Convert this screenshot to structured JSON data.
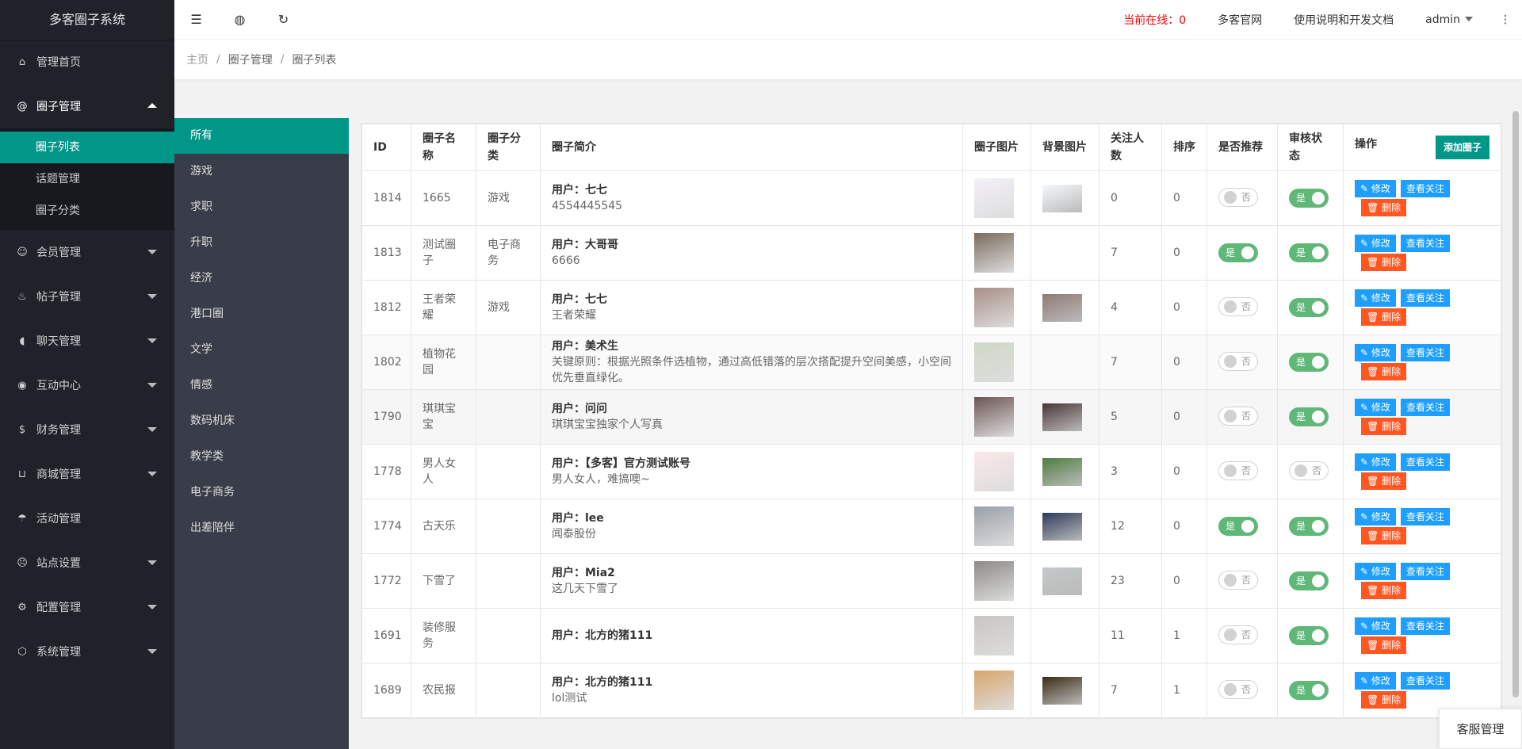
{
  "app": {
    "title": "多客圈子系统"
  },
  "sidebar": {
    "items": [
      {
        "label": "管理首页",
        "icon": "home-icon",
        "glyph": "⌂"
      },
      {
        "label": "圈子管理",
        "icon": "at-icon",
        "glyph": "@",
        "open": true,
        "subs": [
          {
            "label": "圈子列表",
            "active": true
          },
          {
            "label": "话题管理"
          },
          {
            "label": "圈子分类"
          }
        ]
      },
      {
        "label": "会员管理",
        "icon": "user-icon",
        "glyph": "☺",
        "arrow": true
      },
      {
        "label": "帖子管理",
        "icon": "fire-icon",
        "glyph": "♨",
        "arrow": true
      },
      {
        "label": "聊天管理",
        "icon": "speaker-icon",
        "glyph": "◖",
        "arrow": true
      },
      {
        "label": "互动中心",
        "icon": "compass-icon",
        "glyph": "◉",
        "arrow": true
      },
      {
        "label": "财务管理",
        "icon": "dollar-icon",
        "glyph": "$",
        "arrow": true
      },
      {
        "label": "商城管理",
        "icon": "cart-icon",
        "glyph": "⊔",
        "arrow": true
      },
      {
        "label": "活动管理",
        "icon": "umbrella-icon",
        "glyph": "☂"
      },
      {
        "label": "站点设置",
        "icon": "face-icon",
        "glyph": "☹",
        "arrow": true
      },
      {
        "label": "配置管理",
        "icon": "gear-icon",
        "glyph": "⚙",
        "arrow": true
      },
      {
        "label": "系统管理",
        "icon": "cube-icon",
        "glyph": "⬡",
        "arrow": true
      }
    ]
  },
  "header": {
    "online": "当前在线：0",
    "site": "多客官网",
    "docs": "使用说明和开发文档",
    "user": "admin"
  },
  "breadcrumb": [
    "主页",
    "圈子管理",
    "圈子列表"
  ],
  "categories": [
    "所有",
    "游戏",
    "求职",
    "升职",
    "经济",
    "港口圈",
    "文学",
    "情感",
    "数码机床",
    "教学类",
    "电子商务",
    "出差陪伴"
  ],
  "table": {
    "headers": [
      "ID",
      "圈子名称",
      "圈子分类",
      "圈子简介",
      "圈子图片",
      "背景图片",
      "关注人数",
      "排序",
      "是否推荐",
      "审核状态",
      "操作"
    ],
    "add_label": "添加圈子",
    "edit_label": "修改",
    "follow_label": "查看关注",
    "delete_label": "删除",
    "yes": "是",
    "no": "否",
    "rows": [
      {
        "id": "1814",
        "name": "1665",
        "cat": "游戏",
        "user": "用户：七七",
        "desc": "4554445545",
        "img": "#f3f0f7",
        "bg": "#f5f8fb",
        "fans": "0",
        "sort": "0",
        "rec": false,
        "aud": true
      },
      {
        "id": "1813",
        "name": "测试圈子",
        "cat": "电子商务",
        "user": "用户：大哥哥",
        "desc": "6666",
        "img": "#7b6b5c",
        "bg": null,
        "fans": "7",
        "sort": "0",
        "rec": true,
        "aud": true
      },
      {
        "id": "1812",
        "name": "王者荣耀",
        "cat": "游戏",
        "user": "用户：七七",
        "desc": "王者荣耀",
        "img": "#a88f86",
        "bg": "#8f7a74",
        "fans": "4",
        "sort": "0",
        "rec": false,
        "aud": true
      },
      {
        "id": "1802",
        "name": "植物花园",
        "cat": "",
        "user": "用户：美术生",
        "desc": "关键原则：根据光照条件选植物，通过高低错落的层次搭配提升空间美感，小空间优先垂直绿化。",
        "img": "#cfd8c6",
        "bg": null,
        "fans": "7",
        "sort": "0",
        "rec": false,
        "aud": true
      },
      {
        "id": "1790",
        "name": "琪琪宝宝",
        "cat": "",
        "user": "用户：问问",
        "desc": "琪琪宝宝独家个人写真",
        "img": "#6b5554",
        "bg": "#4a3636",
        "fans": "5",
        "sort": "0",
        "rec": false,
        "aud": true
      },
      {
        "id": "1778",
        "name": "男人女人",
        "cat": "",
        "user": "用户：【多客】官方测试账号",
        "desc": "男人女人，难搞噢~",
        "img": "#fbe8ea",
        "bg": "#4f7d3f",
        "fans": "3",
        "sort": "0",
        "rec": false,
        "aud": false
      },
      {
        "id": "1774",
        "name": "古天乐",
        "cat": "",
        "user": "用户：lee",
        "desc": "闻泰股份",
        "img": "#9aa0a8",
        "bg": "#2d3a5a",
        "fans": "12",
        "sort": "0",
        "rec": true,
        "aud": true
      },
      {
        "id": "1772",
        "name": "下雪了",
        "cat": "",
        "user": "用户：Mia2",
        "desc": "这几天下雪了",
        "img": "#8c8a86",
        "bg": "#c3c8c8",
        "fans": "23",
        "sort": "0",
        "rec": false,
        "aud": true
      },
      {
        "id": "1691",
        "name": "装修服务",
        "cat": "",
        "user": "用户：北方的猪111",
        "desc": "",
        "img": "#c9c6c2",
        "bg": null,
        "fans": "11",
        "sort": "1",
        "rec": false,
        "aud": true
      },
      {
        "id": "1689",
        "name": "农民报",
        "cat": "",
        "user": "用户：北方的猪111",
        "desc": "lol测试",
        "img": "#d9a56a",
        "bg": "#3a2d15",
        "fans": "7",
        "sort": "1",
        "rec": false,
        "aud": true
      }
    ]
  },
  "service": "客服管理"
}
